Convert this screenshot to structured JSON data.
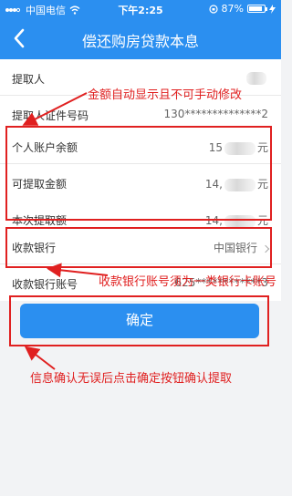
{
  "statusbar": {
    "carrier": "中国电信",
    "time": "下午2:25",
    "battery": "87%"
  },
  "navbar": {
    "title": "偿还购房贷款本息"
  },
  "applicant": {
    "name_label": "提取人",
    "id_label": "提取人证件号码",
    "id_value": "130**************2"
  },
  "balance": {
    "personal_label": "个人账户余额",
    "personal_prefix": "15",
    "personal_unit": "元",
    "extractable_label": "可提取金额",
    "extractable_prefix": "14,",
    "extractable_unit": "元",
    "this_label": "本次提取额",
    "this_prefix": "14,",
    "this_unit": "元"
  },
  "bank": {
    "bank_label": "收款银行",
    "bank_value": "中国银行",
    "account_label": "收款银行账号",
    "account_value": "625************3"
  },
  "confirm_label": "确定",
  "annotations": {
    "auto_amount": "金额自动显示且不可手动修改",
    "bank_account_type": "收款银行账号须为一类银行卡账号",
    "confirm_hint": "信息确认无误后点击确定按钮确认提取"
  },
  "colors": {
    "brand_blue": "#2b8ff0",
    "annotation_red": "#e02020"
  }
}
